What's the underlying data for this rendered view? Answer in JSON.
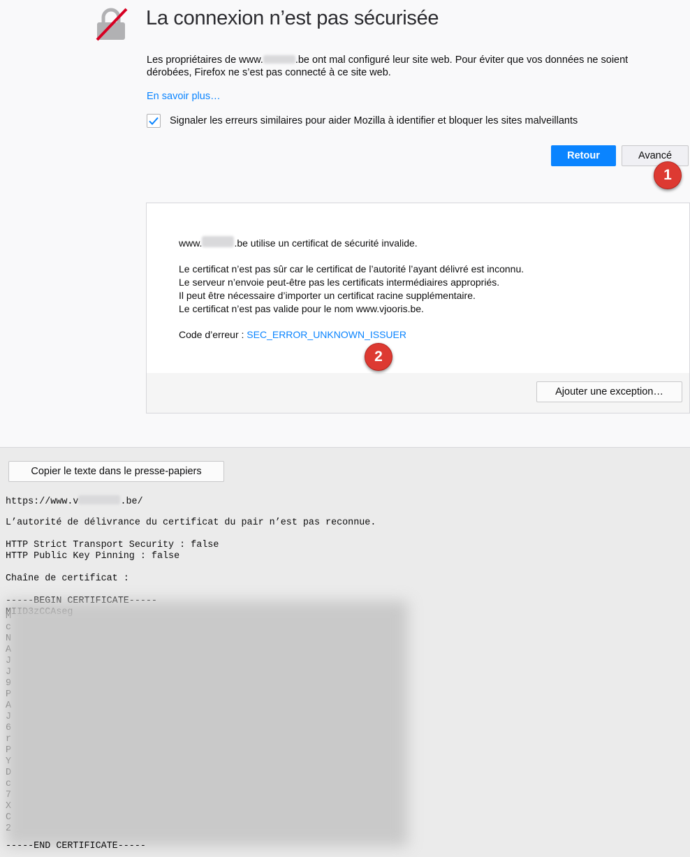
{
  "error": {
    "title": "La connexion n’est pas sécurisée",
    "desc_part1": "Les propriétaires de www.",
    "desc_part2": ".be ont mal configuré leur site web. Pour éviter que vos données ne soient dérobées, Firefox ne s’est pas connecté à ce site web.",
    "learn_more": "En savoir plus…",
    "report_label": "Signaler les erreurs similaires pour aider Mozilla à identifier et bloquer les sites malveillants",
    "report_checked": true,
    "back_button": "Retour",
    "advanced_button": "Avancé"
  },
  "badges": {
    "first": "1",
    "second": "2"
  },
  "advanced": {
    "line1_a": "www.",
    "line1_b": ".be utilise un certificat de sécurité invalide.",
    "reason1": "Le certificat n’est pas sûr car le certificat de l’autorité l’ayant délivré est inconnu.",
    "reason2": "Le serveur n’envoie peut-être pas les certificats intermédiaires appropriés.",
    "reason3": "Il peut être nécessaire d’importer un certificat racine supplémentaire.",
    "reason4": "Le certificat n’est pas valide pour le nom www.vjooris.be.",
    "error_code_label": "Code d’erreur : ",
    "error_code": "SEC_ERROR_UNKNOWN_ISSUER",
    "add_exception": "Ajouter une exception…"
  },
  "technical": {
    "copy_button": "Copier le texte dans le presse-papiers",
    "url_a": "https://www.v",
    "url_b": ".be/",
    "issuer_msg": "L’autorité de délivrance du certificat du pair n’est pas reconnue.",
    "hsts": "HTTP Strict Transport Security : false",
    "hpkp": "HTTP Public Key Pinning : false",
    "chain_label": "Chaîne de certificat :",
    "begin_cert": "-----BEGIN CERTIFICATE-----",
    "cert_first_line": "MIID3zCCAseg",
    "end_cert": "-----END CERTIFICATE-----",
    "cert_edge_chars": [
      "M",
      "c",
      "N",
      "A",
      "J",
      "J",
      "9",
      "P",
      "A",
      "J",
      "6",
      "r",
      "P",
      "Y",
      "D",
      "c",
      "7",
      "X",
      "C",
      "2"
    ]
  },
  "colors": {
    "accent": "#0a84ff",
    "badge": "#dd3a32",
    "lock_slash": "#d70022"
  }
}
